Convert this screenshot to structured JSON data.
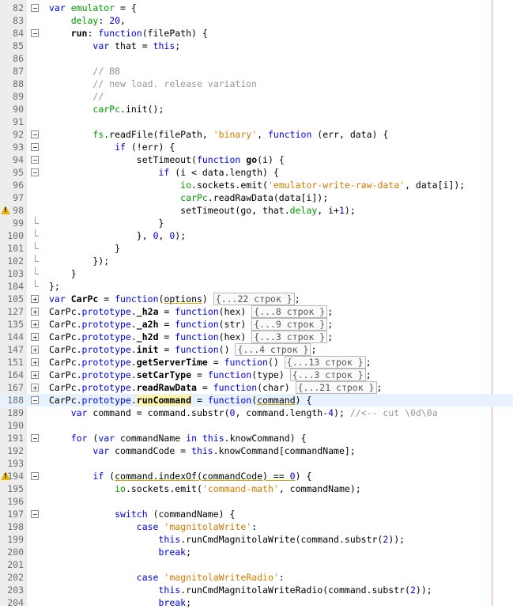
{
  "editor": {
    "lines": [
      {
        "n": "82",
        "fold": "open",
        "html": "<span class='kw'>var</span> <span class='prop'>emulator</span> = {"
      },
      {
        "n": "83",
        "fold": "",
        "html": "    <span class='prop'>delay</span>: <span class='num'>20</span>,"
      },
      {
        "n": "84",
        "fold": "open",
        "html": "    <span class='bold'>run</span>: <span class='kw'>function</span>(filePath) {"
      },
      {
        "n": "85",
        "fold": "",
        "html": "        <span class='kw'>var</span> that = <span class='kw'>this</span>;"
      },
      {
        "n": "86",
        "fold": "",
        "html": ""
      },
      {
        "n": "87",
        "fold": "",
        "html": "        <span class='com'>// BB</span>"
      },
      {
        "n": "88",
        "fold": "",
        "html": "        <span class='com'>// new load. release variation</span>"
      },
      {
        "n": "89",
        "fold": "",
        "html": "        <span class='com'>//</span>"
      },
      {
        "n": "90",
        "fold": "",
        "html": "        <span class='prop'>carPc</span>.init();"
      },
      {
        "n": "91",
        "fold": "",
        "html": ""
      },
      {
        "n": "92",
        "fold": "open",
        "html": "        <span class='prop'>fs</span>.readFile(filePath, <span class='str'>'binary'</span>, <span class='kw'>function</span> (err, data) {"
      },
      {
        "n": "93",
        "fold": "open",
        "html": "            <span class='kw'>if</span> (!err) {"
      },
      {
        "n": "94",
        "fold": "open",
        "html": "                setTimeout(<span class='kw'>function</span> <span class='bold'>go</span>(i) {"
      },
      {
        "n": "95",
        "fold": "open",
        "html": "                    <span class='kw'>if</span> (i &lt; data.length) {"
      },
      {
        "n": "96",
        "fold": "",
        "html": "                        <span class='prop'>io</span>.sockets.emit(<span class='str'>'emulator-write-raw-data'</span>, data[i]);"
      },
      {
        "n": "97",
        "fold": "",
        "html": "                        <span class='prop'>carPc</span>.readRawData(data[i]);"
      },
      {
        "n": "98",
        "fold": "",
        "warn": true,
        "html": "                        setTimeout(go, that.<span class='prop'>delay</span>, i+<span class='num'>1</span>);"
      },
      {
        "n": "99",
        "fold": "end",
        "html": "                    }"
      },
      {
        "n": "100",
        "fold": "end",
        "html": "                }, <span class='num'>0</span>, <span class='num'>0</span>);"
      },
      {
        "n": "101",
        "fold": "end",
        "html": "            }"
      },
      {
        "n": "102",
        "fold": "end",
        "html": "        });"
      },
      {
        "n": "103",
        "fold": "end",
        "html": "    }"
      },
      {
        "n": "104",
        "fold": "end",
        "html": "};"
      },
      {
        "n": "105",
        "fold": "closed",
        "html": "<span class='kw'>var</span> <span class='bold'>CarPc</span> = <span class='kw'>function</span>(<span class='uline'>options</span>) <span class='collapsed'>{...22 строк }</span>;"
      },
      {
        "n": "127",
        "fold": "closed",
        "html": "CarPc.<span class='kw'>prototype</span>.<span class='bold'>_h2a</span> = <span class='kw'>function</span>(hex) <span class='collapsed'>{...8 строк }</span>;"
      },
      {
        "n": "135",
        "fold": "closed",
        "html": "CarPc.<span class='kw'>prototype</span>.<span class='bold'>_a2h</span> = <span class='kw'>function</span>(str) <span class='collapsed'>{...9 строк }</span>;"
      },
      {
        "n": "144",
        "fold": "closed",
        "html": "CarPc.<span class='kw'>prototype</span>.<span class='bold'>_h2d</span> = <span class='kw'>function</span>(hex) <span class='collapsed'>{...3 строк }</span>;"
      },
      {
        "n": "147",
        "fold": "closed",
        "html": "CarPc.<span class='kw'>prototype</span>.<span class='bold'>init</span> = <span class='kw'>function</span>() <span class='collapsed'>{...4 строк }</span>;"
      },
      {
        "n": "151",
        "fold": "closed",
        "html": "CarPc.<span class='kw'>prototype</span>.<span class='bold'>getServerTime</span> = <span class='kw'>function</span>() <span class='collapsed'>{...13 строк }</span>;"
      },
      {
        "n": "164",
        "fold": "closed",
        "html": "CarPc.<span class='kw'>prototype</span>.<span class='bold'>setCarType</span> = <span class='kw'>function</span>(type) <span class='collapsed'>{...3 строк }</span>;"
      },
      {
        "n": "167",
        "fold": "closed",
        "html": "CarPc.<span class='kw'>prototype</span>.<span class='bold'>readRawData</span> = <span class='kw'>function</span>(char) <span class='collapsed'>{...21 строк }</span>;"
      },
      {
        "n": "188",
        "fold": "open",
        "hl": true,
        "html": "CarPc.<span class='kw'>prototype</span>.<span class='bold mark'>runCommand</span> = <span class='kw'>function</span>(<span class='uline'>command</span>) {"
      },
      {
        "n": "189",
        "fold": "",
        "html": "    <span class='kw'>var</span> command = command.substr(<span class='num'>0</span>, command.length-<span class='num'>4</span>); <span class='com'>//&lt;-- cut \\0d\\0a</span>"
      },
      {
        "n": "190",
        "fold": "",
        "html": ""
      },
      {
        "n": "191",
        "fold": "open",
        "html": "    <span class='kw'>for</span> (<span class='kw'>var</span> commandName <span class='kw'>in</span> <span class='kw'>this</span>.knowCommand) {"
      },
      {
        "n": "192",
        "fold": "",
        "html": "        <span class='kw'>var</span> commandCode = <span class='kw'>this</span>.knowCommand[commandName];"
      },
      {
        "n": "193",
        "fold": "",
        "html": ""
      },
      {
        "n": "194",
        "fold": "open",
        "warn": true,
        "html": "        <span class='kw'>if</span> (<span class='uline'>command.indexOf(commandCode) == <span class='num'>0</span></span>) {"
      },
      {
        "n": "195",
        "fold": "",
        "html": "            <span class='prop'>io</span>.sockets.emit(<span class='str'>'command-math'</span>, commandName);"
      },
      {
        "n": "196",
        "fold": "",
        "html": ""
      },
      {
        "n": "197",
        "fold": "open",
        "html": "            <span class='kw'>switch</span> (commandName) {"
      },
      {
        "n": "198",
        "fold": "",
        "html": "                <span class='kw'>case</span> <span class='str'>'magnitolaWrite'</span>:"
      },
      {
        "n": "199",
        "fold": "",
        "html": "                    <span class='kw'>this</span>.runCmdMagnitolaWrite(command.substr(<span class='num'>2</span>));"
      },
      {
        "n": "200",
        "fold": "",
        "html": "                    <span class='kw'>break</span>;"
      },
      {
        "n": "201",
        "fold": "",
        "html": ""
      },
      {
        "n": "202",
        "fold": "",
        "html": "                <span class='kw'>case</span> <span class='str'>'magnitolaWriteRadio'</span>:"
      },
      {
        "n": "203",
        "fold": "",
        "html": "                    <span class='kw'>this</span>.runCmdMagnitolaWriteRadio(command.substr(<span class='num'>2</span>));"
      },
      {
        "n": "204",
        "fold": "",
        "html": "                    <span class='kw'>break</span>;"
      }
    ]
  }
}
